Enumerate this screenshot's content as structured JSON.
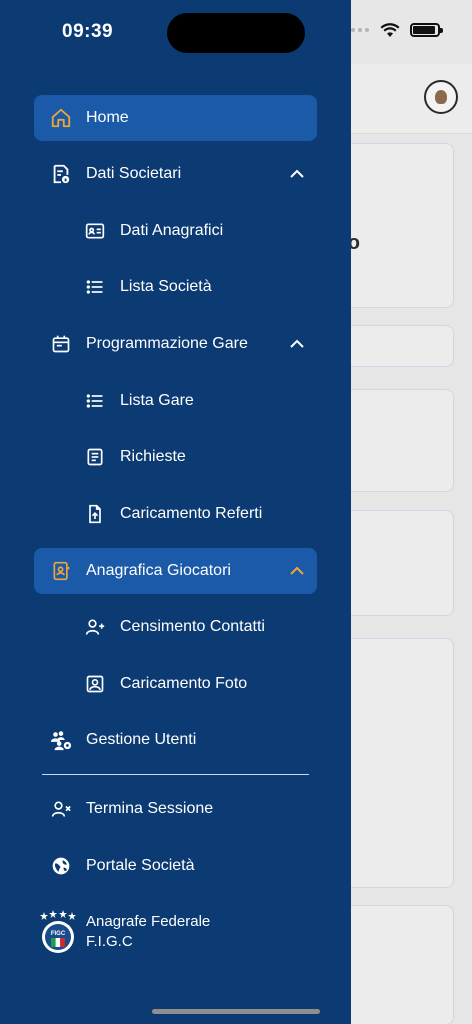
{
  "status_bar": {
    "time": "09:39"
  },
  "menu": {
    "home": "Home",
    "dati_societari": "Dati Societari",
    "dati_anagrafici": "Dati Anagrafici",
    "lista_societa": "Lista Società",
    "programmazione_gare": "Programmazione Gare",
    "lista_gare": "Lista Gare",
    "richieste": "Richieste",
    "caricamento_referti": "Caricamento Referti",
    "anagrafica_giocatori": "Anagrafica Giocatori",
    "censimento_contatti": "Censimento Contatti",
    "caricamento_foto": "Caricamento Foto",
    "gestione_utenti": "Gestione Utenti",
    "termina_sessione": "Termina Sessione",
    "portale_societa": "Portale Società"
  },
  "brand": {
    "line1": "Anagrafe Federale",
    "line2": "F.I.G.C"
  },
  "background": {
    "partial_text": "o"
  },
  "colors": {
    "drawer": "#0c3a73",
    "active": "#1a5aa8",
    "accent": "#f0a53a",
    "text": "#ffffff"
  },
  "icons": {
    "home": "home-icon",
    "dati_societari": "document-info-icon",
    "dati_anagrafici": "id-card-icon",
    "lista": "list-icon",
    "calendar": "calendar-icon",
    "richieste": "document-lines-icon",
    "upload": "file-upload-icon",
    "anagrafica": "contact-book-icon",
    "add_user": "user-plus-icon",
    "photo": "portrait-icon",
    "gestione": "users-gear-icon",
    "logout": "user-x-icon",
    "globe": "globe-icon"
  }
}
